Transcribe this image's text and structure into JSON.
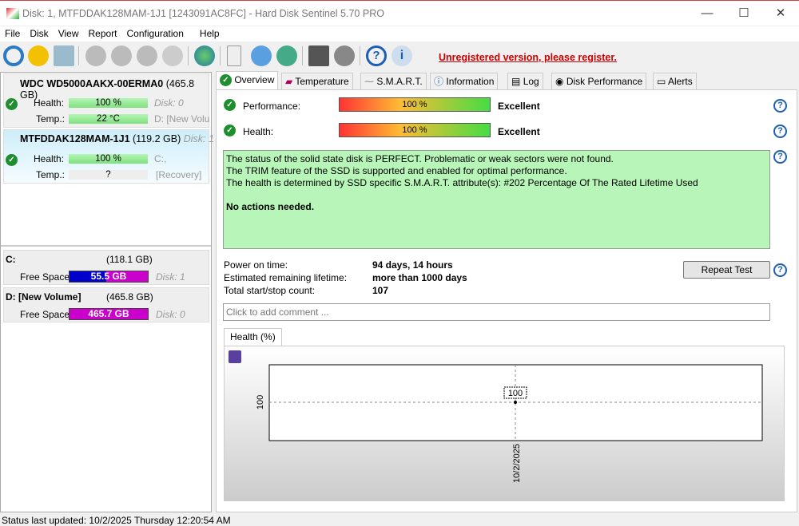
{
  "window": {
    "title": "Disk: 1, MTFDDAK128MAM-1J1 [1243091AC8FC]  -  Hard Disk Sentinel 5.70 PRO",
    "minimize": "—",
    "maximize": "☐",
    "close": "✕"
  },
  "menu": [
    "File",
    "Disk",
    "View",
    "Report",
    "Configuration",
    "Help"
  ],
  "toolbar": {
    "register_link": "Unregistered version, please register.",
    "icons": [
      "refresh-icon",
      "alert-icon",
      "disk-icon",
      "disk-test-icon",
      "disk-clock-icon",
      "disk-check-icon",
      "disk-search-icon",
      "globe-icon",
      "report-icon",
      "sync-icon",
      "network-icon",
      "monitor-icon",
      "speaker-icon",
      "help-icon",
      "info-icon"
    ]
  },
  "disks": [
    {
      "name": "WDC WD5000AAKX-00ERMA0",
      "size": "(465.8 GB)",
      "health_label": "Health:",
      "health": "100 %",
      "temp_label": "Temp.:",
      "temp": "22 °C",
      "side1": "Disk: 0",
      "side2": "D: [New Volu"
    },
    {
      "name": "MTFDDAK128MAM-1J1",
      "size": "(119.2 GB)",
      "disk": "Disk: 1",
      "health_label": "Health:",
      "health": "100 %",
      "temp_label": "Temp.:",
      "temp": "?",
      "side1": "C:,",
      "side2": "[Recovery]"
    }
  ],
  "volumes": [
    {
      "name": "C:",
      "size": "(118.1 GB)",
      "free_label": "Free Space",
      "free": "55.5 GB",
      "used_fraction": 0.47,
      "disk": "Disk: 1"
    },
    {
      "name": "D: [New Volume]",
      "size": "(465.8 GB)",
      "free_label": "Free Space",
      "free": "465.7 GB",
      "used_fraction": 0.0,
      "disk": "Disk: 0"
    }
  ],
  "tabs": [
    "Overview",
    "Temperature",
    "S.M.A.R.T.",
    "Information",
    "Log",
    "Disk Performance",
    "Alerts"
  ],
  "overview": {
    "performance_label": "Performance:",
    "performance": "100 %",
    "performance_rating": "Excellent",
    "health_label": "Health:",
    "health": "100 %",
    "health_rating": "Excellent",
    "message": [
      "The status of the solid state disk is PERFECT. Problematic or weak sectors were not found.",
      "The TRIM feature of the SSD is supported and enabled for optimal performance.",
      "The health is determined by SSD specific S.M.A.R.T. attribute(s):  #202 Percentage Of The Rated Lifetime Used"
    ],
    "action": "No actions needed.",
    "power_on_label": "Power on time:",
    "power_on": "94 days, 14 hours",
    "lifetime_label": "Estimated remaining lifetime:",
    "lifetime": "more than 1000 days",
    "startstop_label": "Total start/stop count:",
    "startstop": "107",
    "repeat_test": "Repeat Test",
    "comment_placeholder": "Click to add comment ...",
    "chart_tab": "Health (%)"
  },
  "chart_data": {
    "type": "line",
    "x": [
      "10/2/2025"
    ],
    "values": [
      100
    ],
    "ytick": "100",
    "data_label": "100"
  },
  "status": "Status last updated: 10/2/2025 Thursday 12:20:54 AM",
  "colors": {
    "accent": "#d00000",
    "health_green": "#7fe07f",
    "volume_used": "#0000cc",
    "volume_free": "#cc00cc",
    "message_bg": "#b8f5b8"
  }
}
